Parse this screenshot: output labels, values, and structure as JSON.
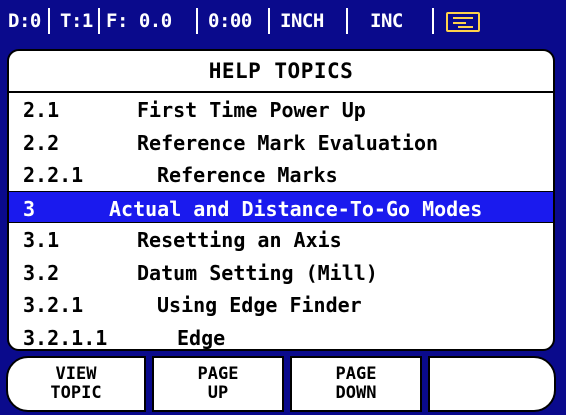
{
  "status_bar": {
    "datum": "D:0",
    "tool": "T:1",
    "feed": "F: 0.0",
    "time": "0:00",
    "units": "INCH",
    "mode": "INC",
    "icon": "axis-status-icon"
  },
  "panel": {
    "title": "HELP TOPICS",
    "items": [
      {
        "num": "2.1",
        "label": "First Time Power Up"
      },
      {
        "num": "2.2",
        "label": "Reference Mark Evaluation"
      },
      {
        "num": "2.2.1",
        "label": "Reference Marks"
      },
      {
        "num": "3",
        "label": "Actual and Distance-To-Go Modes"
      },
      {
        "num": "3.1",
        "label": "Resetting an Axis"
      },
      {
        "num": "3.2",
        "label": "Datum Setting (Mill)"
      },
      {
        "num": "3.2.1",
        "label": "Using Edge Finder"
      },
      {
        "num": "3.2.1.1",
        "label": "Edge"
      }
    ],
    "selected_index": 3
  },
  "softkeys": [
    {
      "line1": "VIEW",
      "line2": "TOPIC"
    },
    {
      "line1": "PAGE",
      "line2": "UP"
    },
    {
      "line1": "PAGE",
      "line2": "DOWN"
    },
    {
      "line1": "",
      "line2": ""
    }
  ],
  "colors": {
    "background": "#0a0a8c",
    "selection": "#1a1aee",
    "panel": "#ffffff",
    "icon_accent": "#ffd24a"
  }
}
